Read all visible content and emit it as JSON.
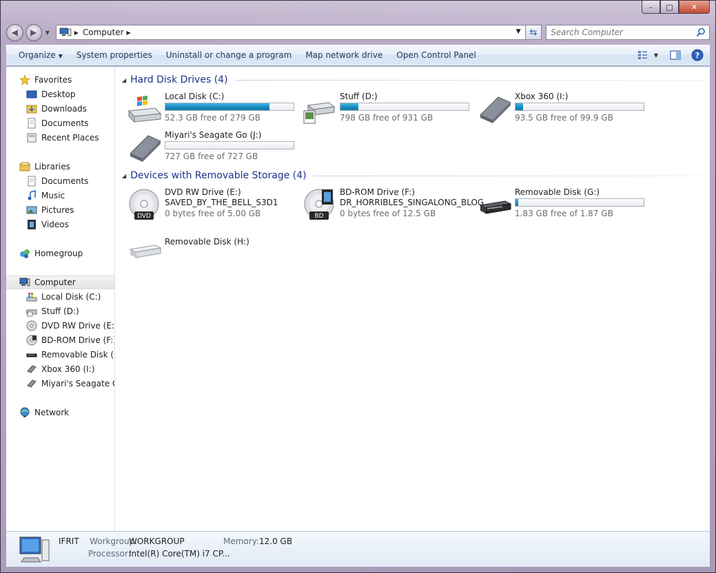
{
  "window": {
    "caption_min": "–",
    "caption_max": "□",
    "caption_close": "✕"
  },
  "address": {
    "crumb": "Computer",
    "search_placeholder": "Search Computer"
  },
  "toolbar": {
    "organize": "Organize",
    "system_properties": "System properties",
    "uninstall": "Uninstall or change a program",
    "map_network": "Map network drive",
    "control_panel": "Open Control Panel"
  },
  "nav": {
    "favorites": "Favorites",
    "desktop": "Desktop",
    "downloads": "Downloads",
    "documents": "Documents",
    "recent_places": "Recent Places",
    "libraries": "Libraries",
    "lib_documents": "Documents",
    "music": "Music",
    "pictures": "Pictures",
    "videos": "Videos",
    "homegroup": "Homegroup",
    "computer": "Computer",
    "drive_c": "Local Disk (C:)",
    "drive_d": "Stuff (D:)",
    "drive_e": "DVD RW Drive (E:) SA",
    "drive_f": "BD-ROM Drive (F:) D",
    "drive_g": "Removable Disk (G:)",
    "drive_i": "Xbox 360 (I:)",
    "drive_j": "Miyari's Seagate Go",
    "network": "Network"
  },
  "groups": {
    "hdd_title": "Hard Disk Drives (4)",
    "removable_title": "Devices with Removable Storage (4)"
  },
  "drives": {
    "c": {
      "name": "Local Disk (C:)",
      "free": "52.3 GB free of 279 GB",
      "used_fraction": 0.81
    },
    "d": {
      "name": "Stuff (D:)",
      "free": "798 GB free of 931 GB",
      "used_fraction": 0.14
    },
    "i": {
      "name": "Xbox 360 (I:)",
      "free": "93.5 GB free of 99.9 GB",
      "used_fraction": 0.06
    },
    "j": {
      "name": "Miyari's Seagate Go (J:)",
      "free": "727 GB free of 727 GB",
      "used_fraction": 0.0
    },
    "e": {
      "name": "DVD RW Drive (E:)",
      "label": "SAVED_BY_THE_BELL_S3D1",
      "free": "0 bytes free of 5.00 GB"
    },
    "f": {
      "name": "BD-ROM Drive (F:)",
      "label": "DR_HORRIBLES_SINGALONG_BLOG",
      "free": "0 bytes free of 12.5 GB"
    },
    "g": {
      "name": "Removable Disk (G:)",
      "free": "1.83 GB free of 1.87 GB",
      "used_fraction": 0.02
    },
    "h": {
      "name": "Removable Disk (H:)"
    }
  },
  "disc_badges": {
    "dvd": "DVD",
    "bd": "BD"
  },
  "details": {
    "computer_name": "IFRIT",
    "workgroup_label": "Workgroup:",
    "workgroup_value": "WORKGROUP",
    "memory_label": "Memory:",
    "memory_value": "12.0 GB",
    "processor_label": "Processor:",
    "processor_value": "Intel(R) Core(TM) i7 CP..."
  },
  "colors": {
    "accent_blue": "#1e3287",
    "bar_fill": "#1b8fc4",
    "toolbar_text": "#1e395b"
  }
}
